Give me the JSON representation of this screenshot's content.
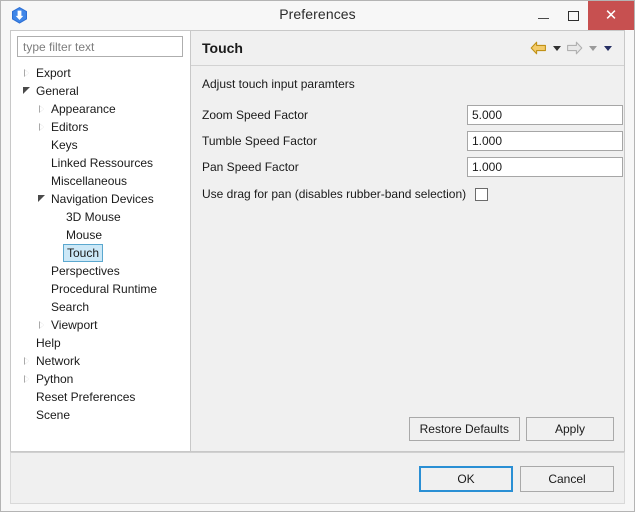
{
  "window": {
    "title": "Preferences",
    "app_icon": "app-logo-icon",
    "controls": {
      "minimize": "minimize-icon",
      "maximize": "maximize-icon",
      "close": "✕"
    }
  },
  "sidebar": {
    "filter": {
      "value": "",
      "placeholder": "type filter text"
    },
    "tree": [
      {
        "label": "Export",
        "indent": 0,
        "state": "collapsed"
      },
      {
        "label": "General",
        "indent": 0,
        "state": "expanded"
      },
      {
        "label": "Appearance",
        "indent": 1,
        "state": "collapsed"
      },
      {
        "label": "Editors",
        "indent": 1,
        "state": "collapsed"
      },
      {
        "label": "Keys",
        "indent": 1,
        "state": "leaf"
      },
      {
        "label": "Linked Ressources",
        "indent": 1,
        "state": "leaf"
      },
      {
        "label": "Miscellaneous",
        "indent": 1,
        "state": "leaf"
      },
      {
        "label": "Navigation Devices",
        "indent": 1,
        "state": "expanded"
      },
      {
        "label": "3D Mouse",
        "indent": 2,
        "state": "leaf"
      },
      {
        "label": "Mouse",
        "indent": 2,
        "state": "leaf"
      },
      {
        "label": "Touch",
        "indent": 2,
        "state": "leaf",
        "selected": true
      },
      {
        "label": "Perspectives",
        "indent": 1,
        "state": "leaf"
      },
      {
        "label": "Procedural Runtime",
        "indent": 1,
        "state": "leaf"
      },
      {
        "label": "Search",
        "indent": 1,
        "state": "leaf"
      },
      {
        "label": "Viewport",
        "indent": 1,
        "state": "collapsed"
      },
      {
        "label": "Help",
        "indent": 0,
        "state": "leaf"
      },
      {
        "label": "Network",
        "indent": 0,
        "state": "collapsed"
      },
      {
        "label": "Python",
        "indent": 0,
        "state": "collapsed"
      },
      {
        "label": "Reset Preferences",
        "indent": 0,
        "state": "leaf"
      },
      {
        "label": "Scene",
        "indent": 0,
        "state": "leaf"
      }
    ]
  },
  "page": {
    "title": "Touch",
    "description": "Adjust touch input paramters",
    "nav": {
      "back_icon": "back-arrow-icon",
      "back_menu_icon": "chevron-down-icon",
      "forward_icon": "forward-arrow-icon",
      "forward_menu_icon": "chevron-down-icon",
      "overflow_menu_icon": "chevron-down-icon"
    },
    "fields": [
      {
        "label": "Zoom Speed Factor",
        "value": "5.000"
      },
      {
        "label": "Tumble Speed Factor",
        "value": "1.000"
      },
      {
        "label": "Pan Speed Factor",
        "value": "1.000"
      }
    ],
    "checkbox": {
      "label": "Use drag for pan (disables rubber-band selection)",
      "checked": false
    },
    "buttons": {
      "restore_defaults": "Restore Defaults",
      "apply": "Apply"
    }
  },
  "footer": {
    "ok": "OK",
    "cancel": "Cancel"
  },
  "colors": {
    "close_button": "#c75050",
    "selection_fill": "#cce8f7",
    "selection_border": "#5ba8cf",
    "default_button_border": "#2a8fd4",
    "panel_background": "#f0f0f0",
    "back_arrow": "#d4a017"
  }
}
